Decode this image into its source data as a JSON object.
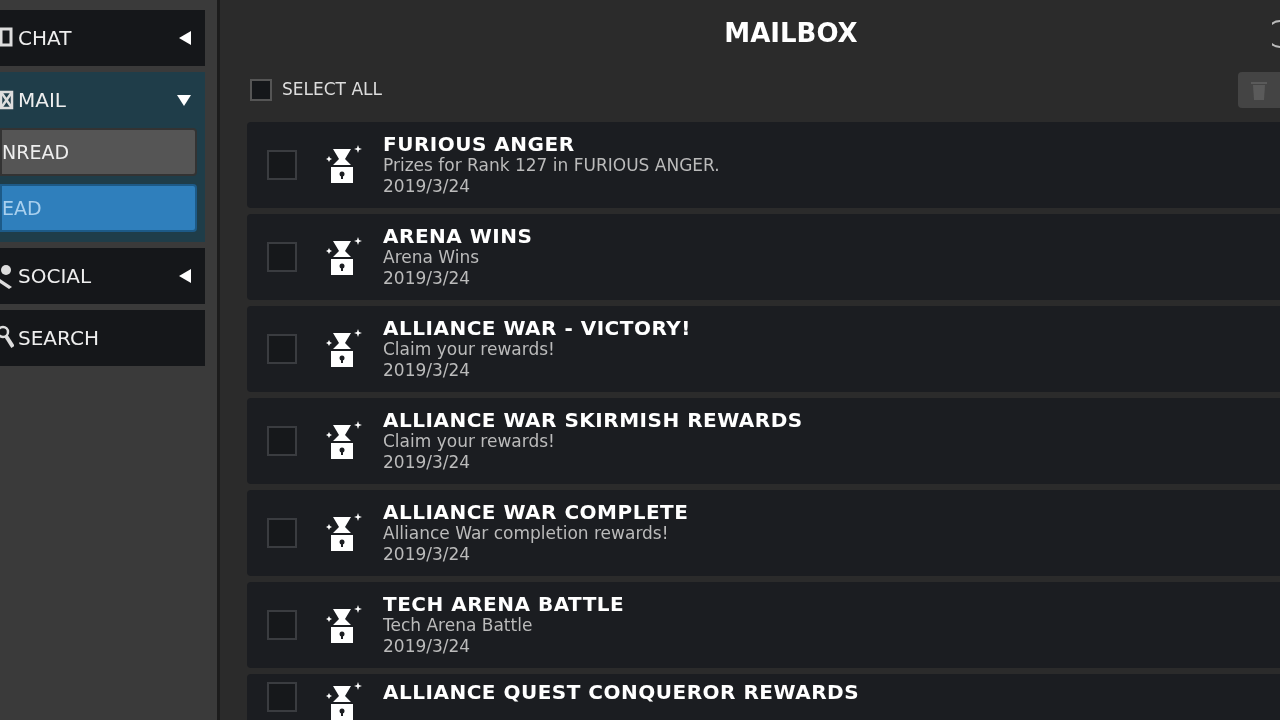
{
  "sidebar": {
    "items": [
      {
        "label": "CHAT",
        "kind": "chat",
        "expanded": false
      },
      {
        "label": "MAIL",
        "kind": "mail",
        "expanded": true,
        "children": [
          {
            "label": "NREAD",
            "selected": false
          },
          {
            "label": "EAD",
            "selected": true
          }
        ]
      },
      {
        "label": "SOCIAL",
        "kind": "social",
        "expanded": false
      },
      {
        "label": "SEARCH",
        "kind": "search"
      }
    ]
  },
  "header": {
    "title": "MAILBOX"
  },
  "toolbar": {
    "select_all": {
      "label": "SELECT ALL",
      "checked": false
    },
    "delete_disabled": true
  },
  "mails": [
    {
      "title": "FURIOUS ANGER",
      "body": "Prizes for Rank 127 in FURIOUS ANGER.",
      "date": "2019/3/24",
      "checked": false
    },
    {
      "title": "ARENA WINS",
      "body": "Arena Wins",
      "date": "2019/3/24",
      "checked": false
    },
    {
      "title": "ALLIANCE WAR - VICTORY!",
      "body": "Claim your rewards!",
      "date": "2019/3/24",
      "checked": false
    },
    {
      "title": "ALLIANCE WAR SKIRMISH REWARDS",
      "body": "Claim your rewards!",
      "date": "2019/3/24",
      "checked": false
    },
    {
      "title": "ALLIANCE WAR COMPLETE",
      "body": "Alliance War completion rewards!",
      "date": "2019/3/24",
      "checked": false
    },
    {
      "title": "TECH ARENA BATTLE",
      "body": "Tech Arena Battle",
      "date": "2019/3/24",
      "checked": false
    },
    {
      "title": "ALLIANCE QUEST CONQUEROR REWARDS",
      "checked": false
    }
  ]
}
